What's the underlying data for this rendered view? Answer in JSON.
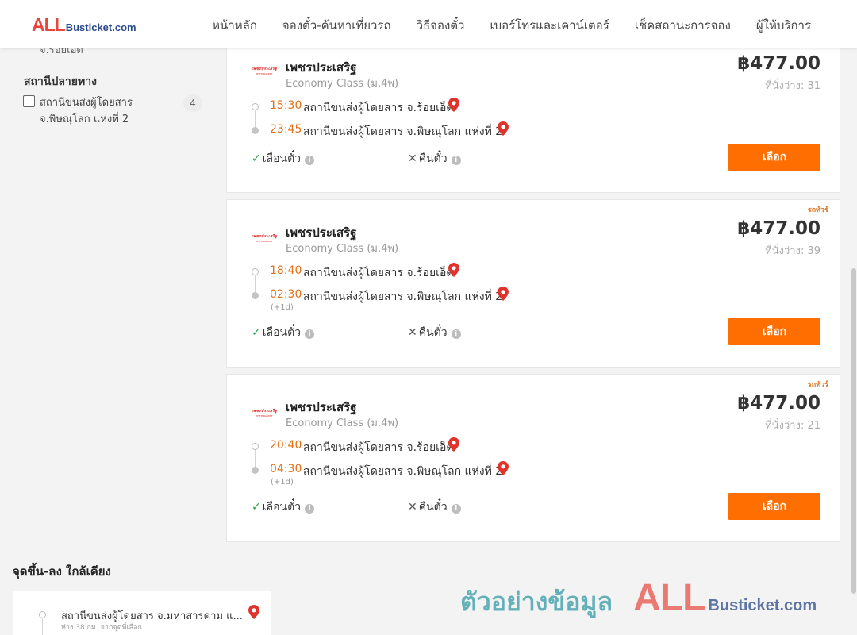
{
  "header": {
    "logo_all": "ALL",
    "logo_rest": "Busticket.com",
    "nav": [
      "หน้าหลัก",
      "จองตั๋ว-ค้นหาเที่ยวรถ",
      "วิธีจองตั๋ว",
      "เบอร์โทรและเคาน์เตอร์",
      "เช็คสถานะการจอง",
      "ผู้ให้บริการ"
    ]
  },
  "sidebar": {
    "cut_text": "จ.ร้อยเอ็ด",
    "dest_title": "สถานีปลายทาง",
    "dest_filter": {
      "label": "สถานีขนส่งผู้โดยสาร จ.พิษณุโลก แห่งที่ 2",
      "count": "4",
      "checked": false
    }
  },
  "trips": [
    {
      "operator": "เพชรประเสริฐ",
      "bus_class": "Economy Class (ม.4พ)",
      "logo_text": "เพชรประเสริฐ",
      "logo_sub": "PHETPRASERT",
      "vip": "",
      "price": "฿477.00",
      "seats": "ที่นั่งว่าง: 31",
      "depart_time": "15:30",
      "depart_station": "สถานีขนส่งผู้โดยสาร จ.ร้อยเอ็ด",
      "arrive_time": "23:45",
      "arrive_station": "สถานีขนส่งผู้โดยสาร จ.พิษณุโลก แห่งที่ 2",
      "next_day": "",
      "feature_change": "เลื่อนตั๋ว",
      "feature_refund": "คืนตั๋ว",
      "select_label": "เลือก"
    },
    {
      "operator": "เพชรประเสริฐ",
      "bus_class": "Economy Class (ม.4พ)",
      "logo_text": "เพชรประเสริฐ",
      "logo_sub": "PHETPRASERT",
      "vip": "รถทัวร์",
      "price": "฿477.00",
      "seats": "ที่นั่งว่าง: 39",
      "depart_time": "18:40",
      "depart_station": "สถานีขนส่งผู้โดยสาร จ.ร้อยเอ็ด",
      "arrive_time": "02:30",
      "arrive_station": "สถานีขนส่งผู้โดยสาร จ.พิษณุโลก แห่งที่ 2",
      "next_day": "(+1d)",
      "feature_change": "เลื่อนตั๋ว",
      "feature_refund": "คืนตั๋ว",
      "select_label": "เลือก"
    },
    {
      "operator": "เพชรประเสริฐ",
      "bus_class": "Economy Class (ม.4พ)",
      "logo_text": "เพชรประเสริฐ",
      "logo_sub": "PHETPRASERT",
      "vip": "รถทัวร์",
      "price": "฿477.00",
      "seats": "ที่นั่งว่าง: 21",
      "depart_time": "20:40",
      "depart_station": "สถานีขนส่งผู้โดยสาร จ.ร้อยเอ็ด",
      "arrive_time": "04:30",
      "arrive_station": "สถานีขนส่งผู้โดยสาร จ.พิษณุโลก แห่งที่ 2",
      "next_day": "(+1d)",
      "feature_change": "เลื่อนตั๋ว",
      "feature_refund": "คืนตั๋ว",
      "select_label": "เลือก"
    }
  ],
  "nearby": {
    "title": "จุดขึ้น-ลง ใกล้เคียง",
    "item_name": "สถานีขนส่งผู้โดยสาร จ.มหาสารคาม แ...",
    "item_dist": "ห่าง 38 กม. จากจุดที่เลือก"
  },
  "watermark": {
    "text": "ตัวอย่างข้อมูล",
    "all": "ALL",
    "rest": "Busticket.com"
  },
  "colors": {
    "accent_orange": "#ff6e00",
    "time_orange": "#e37017",
    "logo_red": "#e8463d",
    "logo_blue": "#2b4b8c",
    "check_green": "#2c9c44",
    "pin_red": "#e0332b"
  }
}
